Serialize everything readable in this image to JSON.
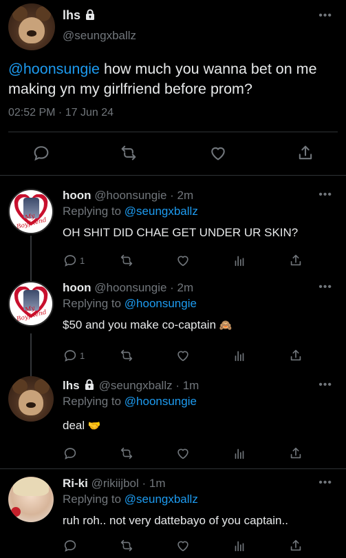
{
  "main_tweet": {
    "author_name": "lhs",
    "handle": "@seungxballz",
    "mention": "@hoonsungie",
    "text": " how much you wanna bet on me making yn my girlfriend before prom?",
    "timestamp": "02:52 PM · 17 Jun 24"
  },
  "replies": [
    {
      "author_name": "hoon",
      "handle_time": "@hoonsungie · 2m",
      "replying_prefix": "Replying to ",
      "replying_to": "@seungxballz",
      "text": "OH SHIT DID CHAE GET UNDER UR SKIN?",
      "reply_count": "1"
    },
    {
      "author_name": "hoon",
      "handle_time": "@hoonsungie · 2m",
      "replying_prefix": "Replying to ",
      "replying_to": "@hoonsungie",
      "text": "$50 and you make co-captain",
      "emoji": "🙈",
      "reply_count": "1"
    },
    {
      "author_name": "lhs",
      "handle_time": "@seungxballz · 1m",
      "replying_prefix": "Replying to ",
      "replying_to": "@hoonsungie",
      "text": "deal",
      "emoji": "🤝",
      "reply_count": ""
    },
    {
      "author_name": "Ri-ki",
      "handle_time": "@rikiijbol · 1m",
      "replying_prefix": "Replying to ",
      "replying_to": "@seungxballz",
      "text": "ruh roh.. not very dattebayo of you captain..",
      "reply_count": ""
    }
  ],
  "avatar_text": {
    "boyfriend_badge": "My Boyfriend"
  },
  "icons": {
    "more": "more-horizontal-icon",
    "reply": "reply-bubble-icon",
    "retweet": "retweet-icon",
    "like": "heart-icon",
    "views": "views-bars-icon",
    "share": "share-icon",
    "lock": "lock-icon"
  },
  "colors": {
    "background": "#000000",
    "text": "#e7e9ea",
    "muted": "#71767b",
    "link": "#1d9bf0",
    "divider": "#2f3336"
  }
}
